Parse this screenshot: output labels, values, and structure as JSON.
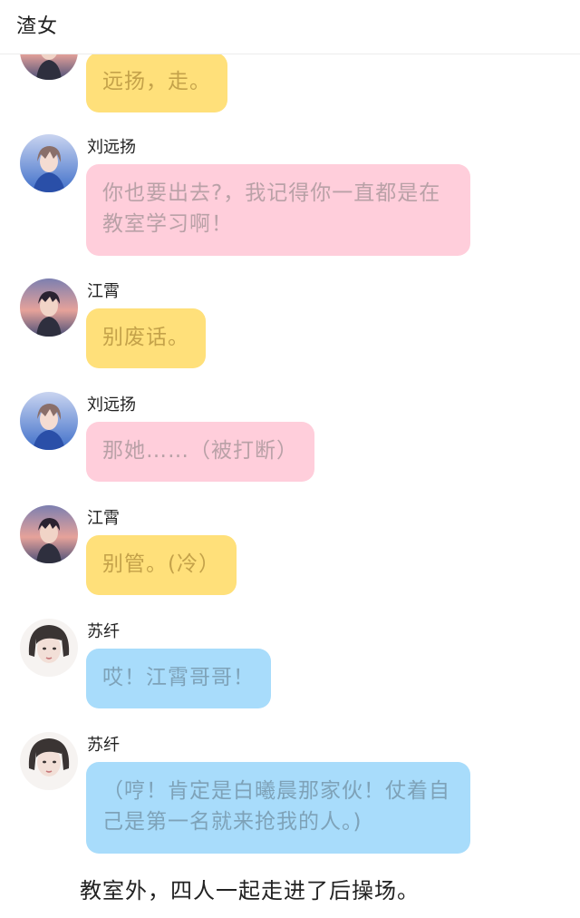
{
  "header": {
    "title": "渣女"
  },
  "messages": [
    {
      "speaker": "",
      "text": "远扬，走。",
      "color": "yellow",
      "avatar": "jiangxiao-avatar"
    },
    {
      "speaker": "刘远扬",
      "text": "你也要出去?，我记得你一直都是在教室学习啊！",
      "color": "pink",
      "avatar": "liuyuanyang-avatar"
    },
    {
      "speaker": "江霄",
      "text": "别废话。",
      "color": "yellow",
      "avatar": "jiangxiao-avatar"
    },
    {
      "speaker": "刘远扬",
      "text": "那她……（被打断）",
      "color": "pink",
      "avatar": "liuyuanyang-avatar"
    },
    {
      "speaker": "江霄",
      "text": "别管。(冷）",
      "color": "yellow",
      "avatar": "jiangxiao-avatar"
    },
    {
      "speaker": "苏纤",
      "text": "哎！江霄哥哥！",
      "color": "blue",
      "avatar": "suqian-avatar"
    },
    {
      "speaker": "苏纤",
      "text": "（哼！肯定是白曦晨那家伙！仗着自己是第一名就来抢我的人。)",
      "color": "blue",
      "avatar": "suqian-avatar"
    }
  ],
  "narration": "教室外，四人一起走进了后操场。",
  "colors": {
    "yellow": "#ffe07a",
    "pink": "#ffcedb",
    "blue": "#a8dcfb"
  }
}
